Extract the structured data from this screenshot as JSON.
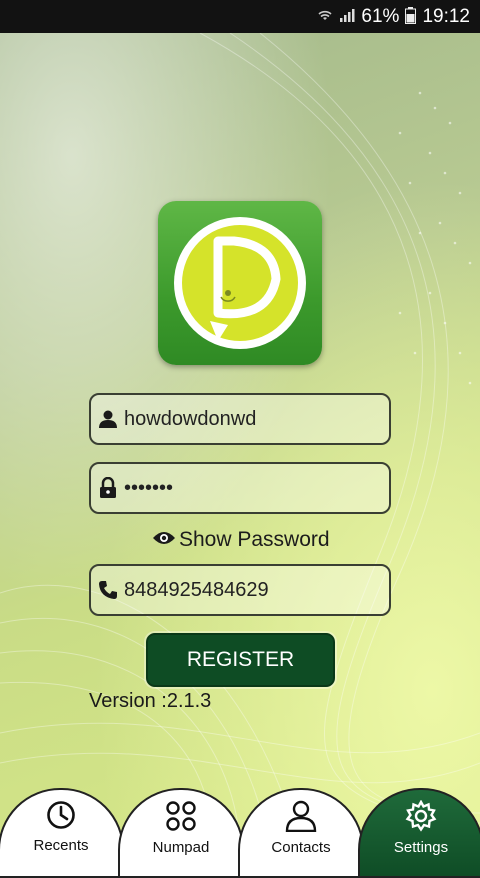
{
  "status_bar": {
    "battery": "61%",
    "time": "19:12",
    "icons": [
      "wifi-icon",
      "signal-icon",
      "battery-icon"
    ]
  },
  "form": {
    "username_value": "howdowdonwd",
    "password_value": "•••••••",
    "show_password_label": "Show Password",
    "phone_value": "8484925484629",
    "register_label": "REGISTER",
    "version_text": "Version :2.1.3"
  },
  "tabs": [
    {
      "label": "Recents",
      "icon": "clock-icon"
    },
    {
      "label": "Numpad",
      "icon": "numpad-icon"
    },
    {
      "label": "Contacts",
      "icon": "contacts-icon"
    },
    {
      "label": "Settings",
      "icon": "gear-icon",
      "active": true
    }
  ],
  "colors": {
    "accent": "#0e4c24",
    "logo_green": "#4aa836",
    "logo_yellow": "#d5e32a"
  }
}
